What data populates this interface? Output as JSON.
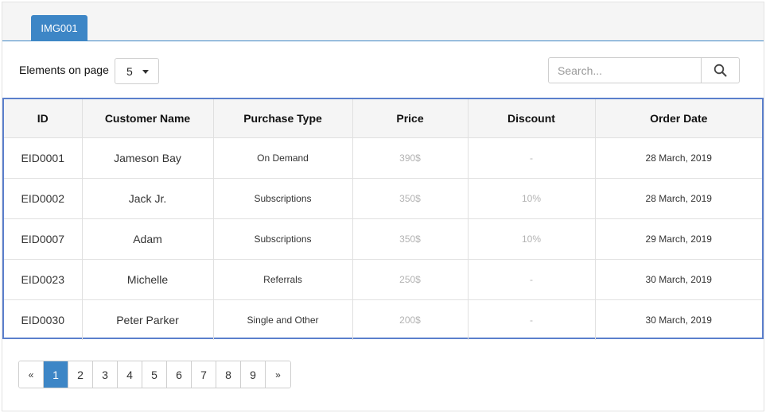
{
  "tabs": [
    {
      "label": "IMG001"
    }
  ],
  "toolbar": {
    "elements_label": "Elements on page",
    "page_size": "5",
    "search_placeholder": "Search..."
  },
  "table": {
    "headers": [
      "ID",
      "Customer Name",
      "Purchase Type",
      "Price",
      "Discount",
      "Order Date"
    ],
    "rows": [
      [
        "EID0001",
        "Jameson Bay",
        "On Demand",
        "390$",
        "-",
        "28 March, 2019"
      ],
      [
        "EID0002",
        "Jack Jr.",
        "Subscriptions",
        "350$",
        "10%",
        "28 March, 2019"
      ],
      [
        "EID0007",
        "Adam",
        "Subscriptions",
        "350$",
        "10%",
        "29 March, 2019"
      ],
      [
        "EID0023",
        "Michelle",
        "Referrals",
        "250$",
        "-",
        "30 March, 2019"
      ],
      [
        "EID0030",
        "Peter Parker",
        "Single and Other",
        "200$",
        "-",
        "30 March, 2019"
      ]
    ]
  },
  "pagination": {
    "prev": "«",
    "pages": [
      "1",
      "2",
      "3",
      "4",
      "5",
      "6",
      "7",
      "8",
      "9"
    ],
    "next": "»",
    "active": "1"
  },
  "colors": {
    "accent": "#3d86c6",
    "table_border": "#5b7fcc"
  },
  "icons": {
    "search": "search-icon",
    "dropdown": "chevron-down-icon"
  }
}
